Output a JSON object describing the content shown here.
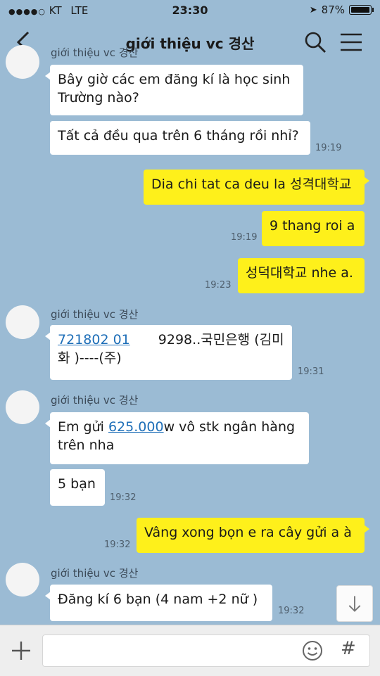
{
  "status_bar": {
    "carrier": "KT",
    "network": "LTE",
    "time": "23:30",
    "battery": "87%",
    "battery_level": 0.87
  },
  "header": {
    "title": "giới thiệu vc 경산"
  },
  "sender_name": "giới thiệu vc 경산",
  "messages": [
    {
      "text_1": "Bây giờ các em đăng kí là học sinh",
      "text_2": "Trường nào?"
    },
    {
      "text": "Tất cả đều qua trên 6 tháng rồi nhỉ?",
      "time": "19:19"
    },
    {
      "text": "Dia chi tat ca deu la 성격대학교"
    },
    {
      "text": "9 thang roi a",
      "time": "19:19"
    },
    {
      "text": "성덕대학교 nhe a.",
      "time": "19:23"
    },
    {
      "link": "721802 01",
      "text_1_rest": "9298..국민은행 (김미",
      "text_2": "화 )----(주)",
      "time": "19:31"
    },
    {
      "text_1_pre": "Em gửi ",
      "amount": "625.000",
      "text_1_post": "w vô stk ngân hàng",
      "text_2": "trên nha"
    },
    {
      "text": "5 bạn",
      "time": "19:32"
    },
    {
      "text": "Vâng xong bọn e ra cây gửi a à",
      "time": "19:32"
    },
    {
      "text": "Đăng kí 6 bạn  (4 nam +2 nữ )",
      "time": "19:32"
    }
  ],
  "input": {
    "placeholder": ""
  },
  "colors": {
    "background": "#9bbbd4",
    "my_bubble": "#fef01b",
    "their_bubble": "#ffffff",
    "link": "#1f6fb8"
  },
  "icons": [
    "back-arrow-icon",
    "search-icon",
    "menu-icon",
    "arrow-down-icon",
    "plus-icon",
    "emoji-icon",
    "hash-icon"
  ]
}
